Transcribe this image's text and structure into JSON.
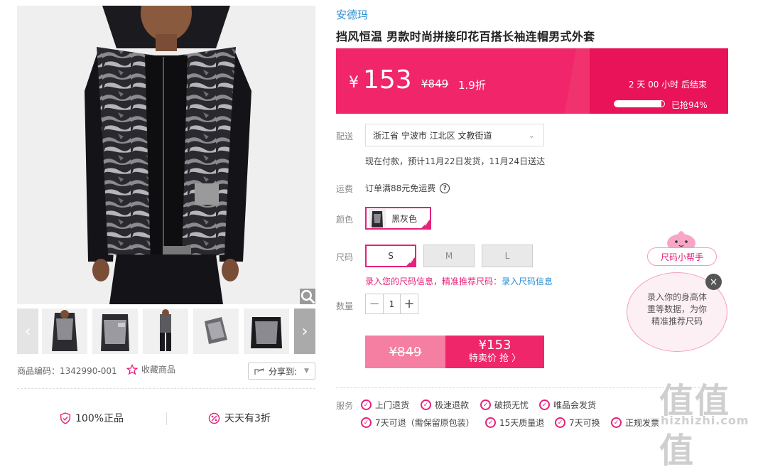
{
  "product": {
    "brand": "安德玛",
    "title": "挡风恒温 男款时尚拼接印花百搭长袖连帽男式外套",
    "sku_label": "商品编码：1342990-001",
    "favorite_label": "收藏商品",
    "share_label": "分享到:"
  },
  "price": {
    "currency": "¥",
    "current": "153",
    "original": "¥849",
    "discount": "1.9折",
    "countdown": "2 天 00 小时 后结束",
    "sold_text": "已抢94%",
    "sold_fraction": 0.94
  },
  "delivery": {
    "label": "配送",
    "address": "浙江省 宁波市 江北区 文教街道",
    "eta": "现在付款，预计11月22日发货，11月24日送达"
  },
  "shipping": {
    "label": "运费",
    "text": "订单满88元免运费"
  },
  "color": {
    "label": "颜色",
    "selected": "黑灰色"
  },
  "size": {
    "label": "尺码",
    "options": [
      "S",
      "M",
      "L"
    ],
    "selected": "S",
    "hint_prefix": "录入您的尺码信息，精准推荐尺码：",
    "hint_link": "录入尺码信息"
  },
  "quantity": {
    "label": "数量",
    "value": "1",
    "minus": "−",
    "plus": "+"
  },
  "buy": {
    "old_price": "¥849",
    "new_price": "¥153",
    "cta": "特卖价 抢 〉"
  },
  "services": {
    "label": "服务",
    "items": [
      "上门退货",
      "极速退款",
      "破损无忧",
      "唯品会发货",
      "7天可退（需保留原包装）",
      "15天质量退",
      "7天可换",
      "正规发票"
    ]
  },
  "badges": {
    "authentic": "100%正品",
    "daily": "天天有3折"
  },
  "helper": {
    "tag": "尺码小帮手",
    "line1": "录入你的身高体",
    "line2": "重等数据，为你",
    "line3": "精准推荐尺码",
    "close": "×"
  },
  "watermark": {
    "main": "值值值",
    "sub": "hizhizhi.com"
  },
  "colors": {
    "accent": "#f1266a",
    "brand_link": "#2a8fd6"
  }
}
